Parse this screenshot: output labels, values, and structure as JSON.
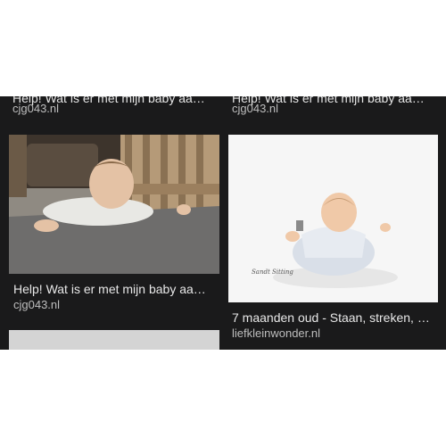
{
  "results": [
    {
      "title_clipped": "Help! Wat is er met mijn baby aan ...",
      "source": "cjg043.nl"
    },
    {
      "title_clipped": "Help! Wat is er met mijn baby aan ...",
      "source": "cjg043.nl"
    },
    {
      "title": "Help! Wat is er met mijn baby aan ...",
      "source": "cjg043.nl",
      "image_alt": "baby lying on stomach on rug"
    },
    {
      "title": "7 maanden oud - Staan, streken, sl...",
      "source": "liefkleinwonder.nl",
      "image_alt": "baby sitting on white background",
      "watermark": "Sandt Sitting"
    },
    {
      "image_alt": "loading image"
    }
  ]
}
